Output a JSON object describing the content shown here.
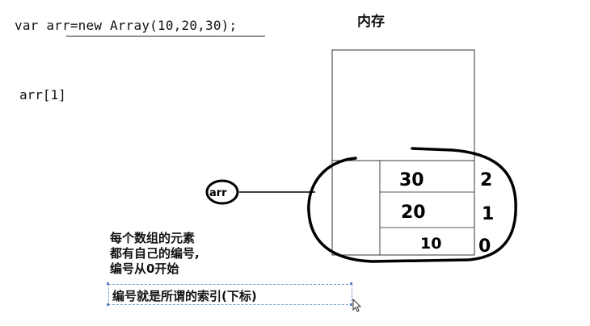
{
  "code": {
    "declaration": "var arr=new Array(10,20,30);",
    "index_expression": "arr[1]"
  },
  "memory": {
    "title": "内存",
    "variable_label": "arr",
    "cells": [
      {
        "value": "30",
        "index": "2"
      },
      {
        "value": "20",
        "index": "1"
      },
      {
        "value": "10",
        "index": "0"
      }
    ]
  },
  "notes": {
    "lines": [
      "每个数组的元素",
      "都有自己的编号,",
      "编号从0开始"
    ],
    "index_note": "编号就是所谓的索引(下标)"
  }
}
